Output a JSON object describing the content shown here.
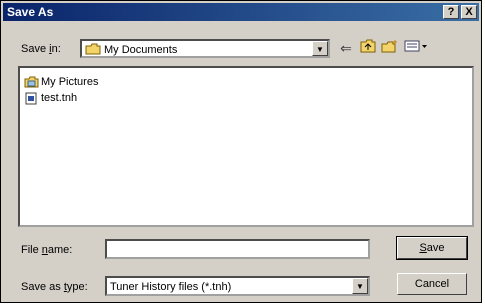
{
  "window": {
    "title": "Save As",
    "help_button": "?",
    "close_button": "X"
  },
  "save_in": {
    "label_prefix": "Save ",
    "label_underline": "i",
    "label_suffix": "n:",
    "value": "My Documents",
    "folder_icon": "folder-icon"
  },
  "toolbar": {
    "back_icon": "back-arrow-icon",
    "up_icon": "up-folder-icon",
    "new_folder_icon": "new-folder-icon",
    "view_icon": "view-menu-icon"
  },
  "files": [
    {
      "name": "My Pictures",
      "icon": "pictures-folder-icon"
    },
    {
      "name": "test.tnh",
      "icon": "file-icon"
    }
  ],
  "file_name": {
    "label_prefix": "File ",
    "label_underline": "n",
    "label_suffix": "ame:",
    "value": ""
  },
  "save_as_type": {
    "label_prefix": "Save as ",
    "label_underline": "t",
    "label_suffix": "ype:",
    "value": "Tuner History files (*.tnh)"
  },
  "buttons": {
    "save_underline": "S",
    "save_rest": "ave",
    "cancel": "Cancel"
  }
}
